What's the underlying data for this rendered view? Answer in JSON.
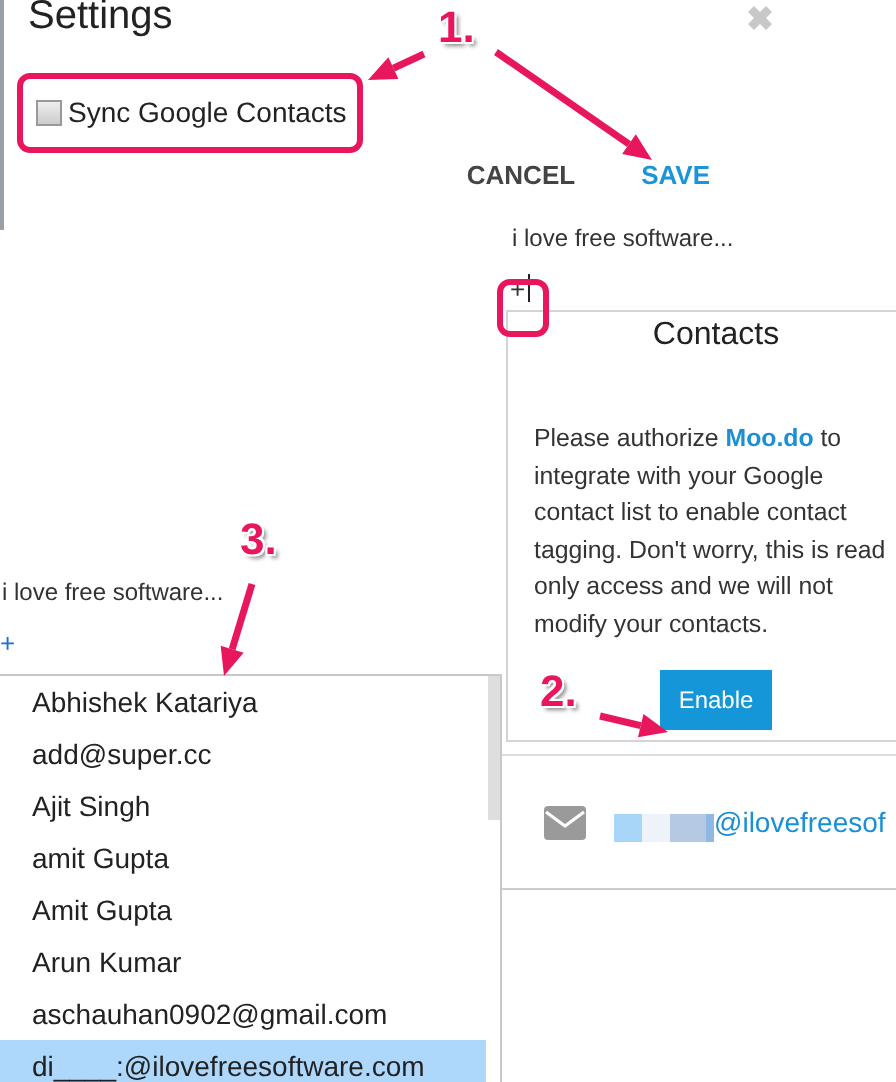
{
  "window": {
    "title": "Settings"
  },
  "sync_google_contacts": {
    "label": "Sync Google Contacts",
    "checked": false
  },
  "actions": [
    {
      "label": "CANCEL",
      "kind": "cancel"
    },
    {
      "label": "SAVE",
      "kind": "save"
    }
  ],
  "task_panel": {
    "text": "i love free software...",
    "add": "+"
  },
  "contacts_card": {
    "title": "Contacts",
    "message": "Please authorize **Moo.do** to integrate with your Google contact list to enable contact tagging. Don't worry, this is read only access and we will not modify your contacts.",
    "button": "Enable"
  },
  "email_row": {
    "address": "@ilovefreesof"
  },
  "left_panel": {
    "text": "i love free software...",
    "add": "+"
  },
  "contact_suggestions": [
    {
      "name": "Abhishek Katariya",
      "selected": false
    },
    {
      "name": "add@super.cc",
      "selected": false
    },
    {
      "name": "Ajit Singh",
      "selected": false
    },
    {
      "name": "amit Gupta",
      "selected": false
    },
    {
      "name": "Amit Gupta",
      "selected": false
    },
    {
      "name": "Arun Kumar",
      "selected": false
    },
    {
      "name": "aschauhan0902@gmail.com",
      "selected": false
    },
    {
      "name": "di____:@ilovefreesoftware.com",
      "selected": true
    }
  ],
  "annotations": [
    {
      "label": "1."
    },
    {
      "label": "2."
    },
    {
      "label": "3."
    }
  ]
}
